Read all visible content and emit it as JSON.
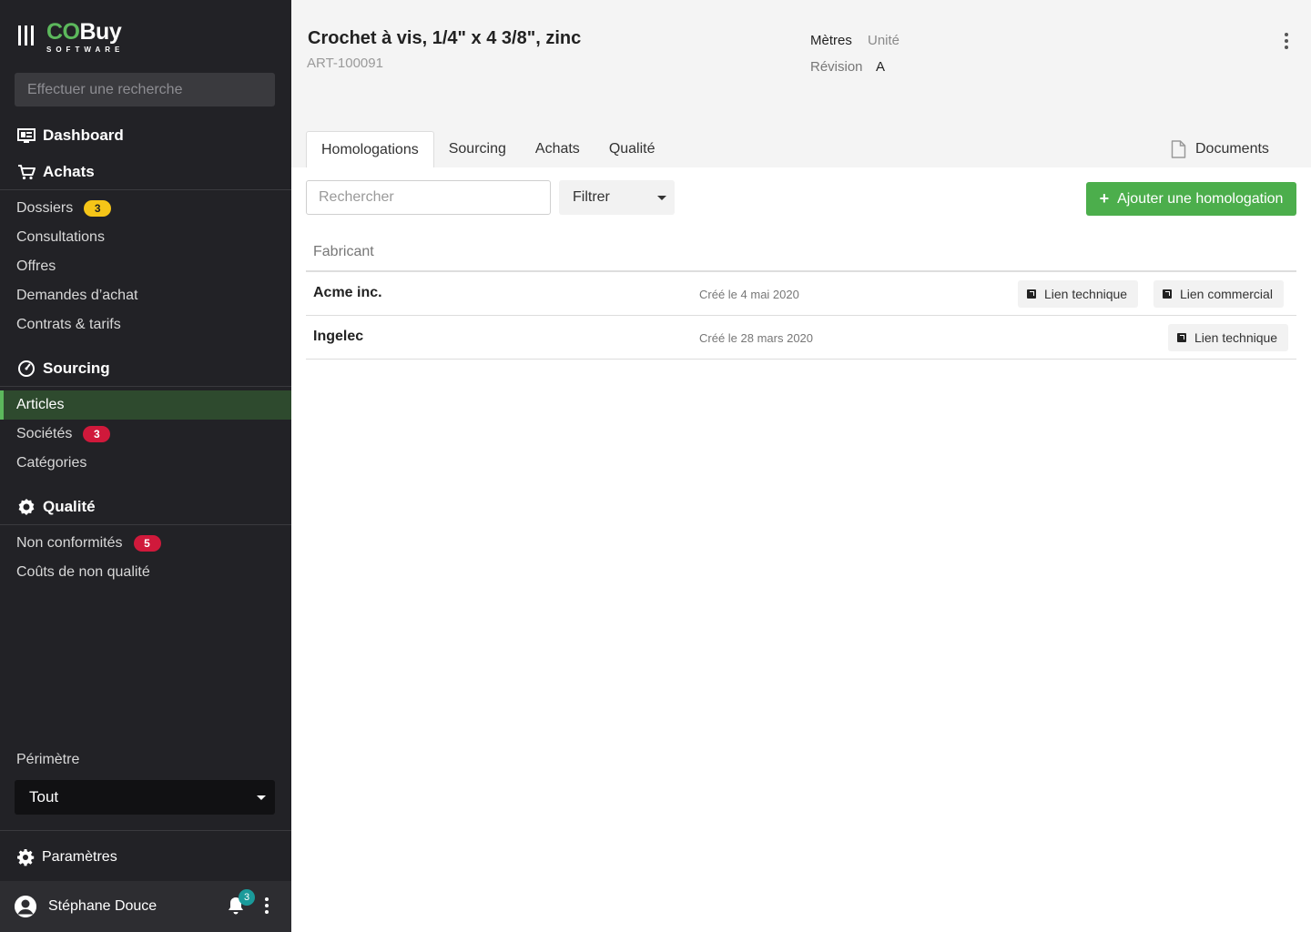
{
  "brand": {
    "name_part1": "CO",
    "name_part2": "Buy",
    "subtitle": "SOFTWARE"
  },
  "sidebar": {
    "search_placeholder": "Effectuer une recherche",
    "dashboard": "Dashboard",
    "achats": {
      "label": "Achats",
      "items": [
        {
          "label": "Dossiers",
          "badge": "3"
        },
        {
          "label": "Consultations"
        },
        {
          "label": "Offres"
        },
        {
          "label": "Demandes d’achat"
        },
        {
          "label": "Contrats & tarifs"
        }
      ]
    },
    "sourcing": {
      "label": "Sourcing",
      "items": [
        {
          "label": "Articles"
        },
        {
          "label": "Sociétés",
          "badge": "3"
        },
        {
          "label": "Catégories"
        }
      ]
    },
    "qualite": {
      "label": "Qualité",
      "items": [
        {
          "label": "Non conformités",
          "badge": "5"
        },
        {
          "label": "Coûts de non qualité"
        }
      ]
    },
    "perimetre": {
      "label": "Périmètre",
      "value": "Tout"
    },
    "settings": "Paramètres",
    "user": {
      "name": "Stéphane Douce",
      "notifications": "3"
    }
  },
  "item": {
    "title": "Crochet à vis, 1/4\" x 4 3/8\", zinc",
    "ref": "ART-100091",
    "unit_label": "Mètres",
    "unit_value": "Unité",
    "revision_label": "Révision",
    "revision_value": "A"
  },
  "tabs": [
    "Homologations",
    "Sourcing",
    "Achats",
    "Qualité"
  ],
  "documents_tab": "Documents",
  "toolbar": {
    "search_placeholder": "Rechercher",
    "filter_label": "Filtrer",
    "add_button": "Ajouter une homologation"
  },
  "table": {
    "header": "Fabricant",
    "rows": [
      {
        "name": "Acme inc.",
        "date": "Créé le 4 mai 2020",
        "links": [
          "Lien technique",
          "Lien commercial"
        ]
      },
      {
        "name": "Ingelec",
        "date": "Créé le 28 mars 2020",
        "links": [
          "Lien technique"
        ]
      }
    ]
  },
  "colors": {
    "sidebar_bg": "#222226",
    "accent_green": "#5cb85c",
    "button_green": "#4cae4c",
    "badge_yellow": "#f5c518",
    "badge_red": "#d0193b"
  }
}
